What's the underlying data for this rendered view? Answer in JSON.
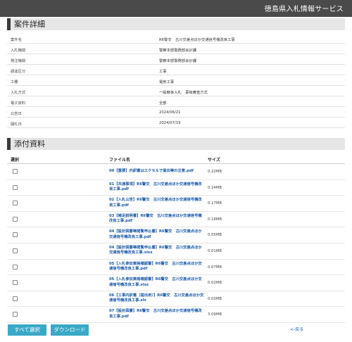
{
  "header": {
    "site_title": "徳島県入札情報サービス"
  },
  "detail_section": {
    "title": "案件詳細",
    "rows": [
      {
        "label": "案件名",
        "value": "R6警交　古川交差点ほか交通信号機改良工事"
      },
      {
        "label": "入札機関",
        "value": "警察本部警務部会計課"
      },
      {
        "label": "発注機関",
        "value": "警察本部警務部会計課"
      },
      {
        "label": "調達区分",
        "value": "工事"
      },
      {
        "label": "工種",
        "value": "電気工事"
      },
      {
        "label": "入札方式",
        "value": "一般競争入札　事後審査方式"
      },
      {
        "label": "電子資料",
        "value": "全部"
      },
      {
        "label": "公告日",
        "value": "2024/06/21"
      },
      {
        "label": "開札日",
        "value": "2024/07/19"
      }
    ]
  },
  "attachments": {
    "title": "添付資料",
    "headers": {
      "select": "選択",
      "filename": "ファイル名",
      "size": "サイズ"
    },
    "files": [
      {
        "name": "00【重要】内訳書はエクセルで提出等の注意.pdf",
        "size": "0.22MB"
      },
      {
        "name": "01【共通事項】R6警交　古川交差点ほか交通信号機改良工事.pdf",
        "size": "0.24MB"
      },
      {
        "name": "02【入札公告】R6警交　古川交差点ほか交通信号機改良工事.pdf",
        "size": "0.17MB"
      },
      {
        "name": "03【補足説明書】R6警交　古川交差点ほか交通信号機改良工事.pdf",
        "size": "0.18MB"
      },
      {
        "name": "04【設計図書等閲覧申込書】R6警交　古川交差点ほか交通信号機改良工事.pdf",
        "size": "0.05MB"
      },
      {
        "name": "04【設計図書等閲覧申込書】R6警交　古川交差点ほか交通信号機改良工事.xlsx",
        "size": "0.01MB"
      },
      {
        "name": "05【入札参加資格確認書】R6警交　古川交差点ほか交通信号機改良工事.pdf",
        "size": "0.07MB"
      },
      {
        "name": "05【入札参加資格確認書】R6警交　古川交差点ほか交通信号機改良工事.xlsx",
        "size": "0.02MB"
      },
      {
        "name": "06【工事内訳書（提出用）】R6警交　古川交差点ほか交通信号機改良工事.xls",
        "size": "0.03MB"
      },
      {
        "name": "07【設計図書】R6警交　古川交差点ほか交通信号機改良工事.pdf",
        "size": "3.09MB"
      }
    ]
  },
  "actions": {
    "select_all": "すべて選択",
    "download": "ダウンロード",
    "back": "<-戻る"
  }
}
